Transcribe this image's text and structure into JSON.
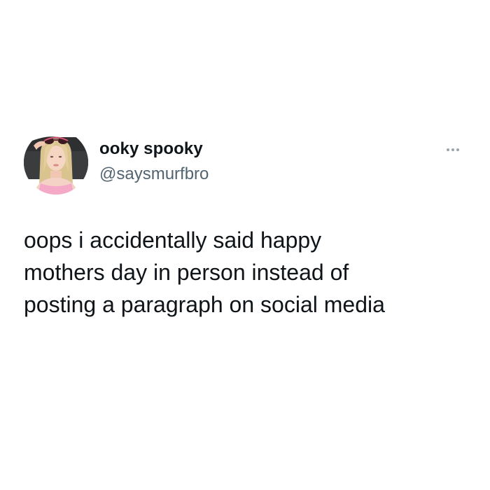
{
  "tweet": {
    "author": {
      "display_name": "ooky spooky",
      "handle": "@saysmurfbro",
      "avatar_icon": "profile-photo"
    },
    "more_icon": "more-horizontal-icon",
    "text_lines": [
      "oops i accidentally said happy",
      "mothers day in person instead of",
      "posting a paragraph on social media"
    ]
  },
  "colors": {
    "background": "#ffffff",
    "text_primary": "#0f1419",
    "text_secondary": "#536471",
    "icon_muted": "#9aa4ad"
  }
}
